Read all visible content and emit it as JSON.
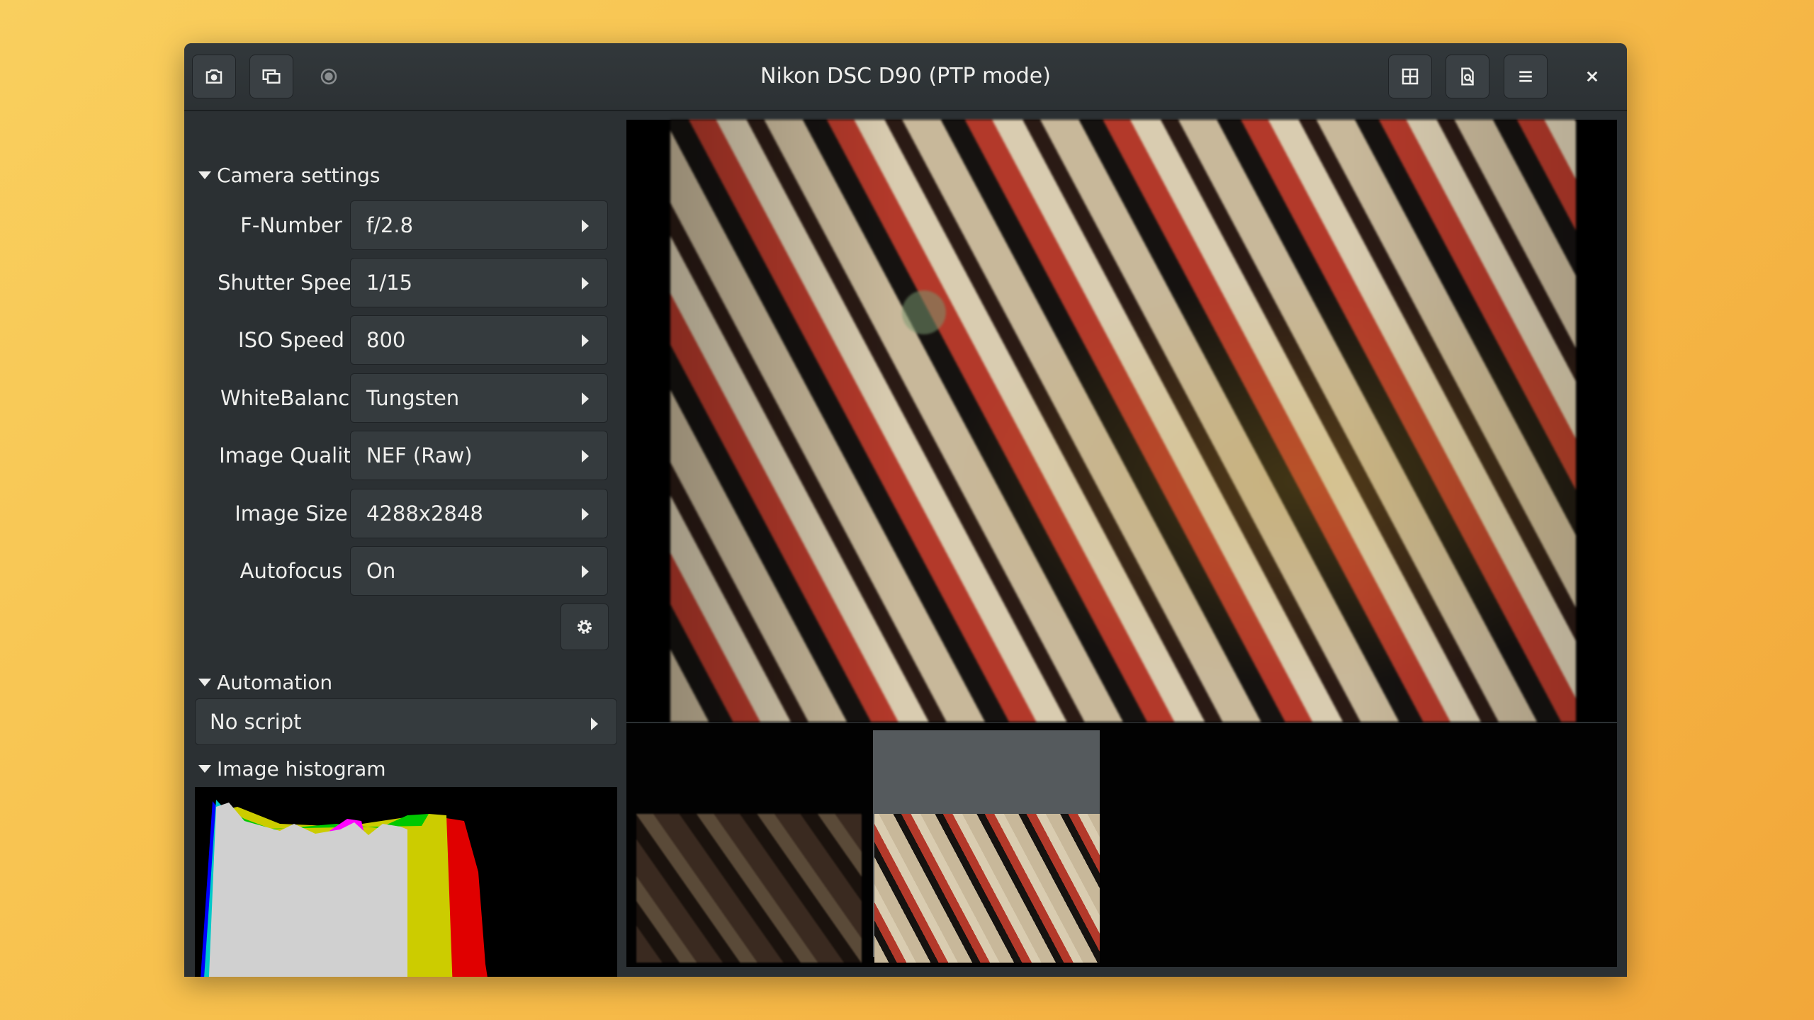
{
  "window": {
    "title": "Nikon DSC D90 (PTP mode)",
    "header_left_buttons": [
      {
        "icon": "camera-icon"
      },
      {
        "icon": "switch-cameras-icon"
      },
      {
        "icon": "record-icon"
      }
    ],
    "header_right_buttons": [
      {
        "icon": "grid-icon"
      },
      {
        "icon": "document-search-icon"
      },
      {
        "icon": "menu-icon"
      },
      {
        "icon": "close-icon"
      }
    ]
  },
  "camera_settings": {
    "header": "Camera settings",
    "rows": [
      {
        "label": "F-Number",
        "value": "f/2.8"
      },
      {
        "label": "Shutter Speed",
        "value": "1/15"
      },
      {
        "label": "ISO Speed",
        "value": "800"
      },
      {
        "label": "WhiteBalance",
        "value": "Tungsten"
      },
      {
        "label": "Image Quality",
        "value": "NEF (Raw)"
      },
      {
        "label": "Image Size",
        "value": "4288x2848"
      },
      {
        "label": "Autofocus",
        "value": "On"
      }
    ]
  },
  "automation": {
    "header": "Automation",
    "value": "No script"
  },
  "histogram": {
    "header": "Image histogram",
    "channel_colors": [
      "#0000ff",
      "#00c8c8",
      "#00c800",
      "#cccc00",
      "#e00000",
      "#d0d0d0",
      "#ff00ff"
    ]
  },
  "thumbnails": {
    "count": 2,
    "selected_index": 1
  }
}
